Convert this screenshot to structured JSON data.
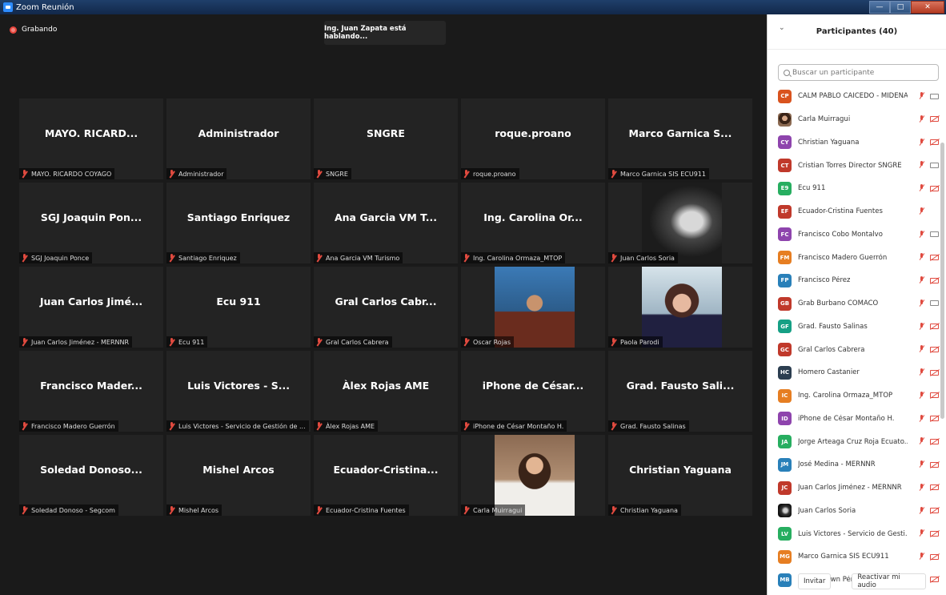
{
  "window": {
    "title": "Zoom Reunión"
  },
  "meeting": {
    "recording_label": "Grabando",
    "speaking_label": "Ing. Juan Zapata está hablando...",
    "tiles": [
      {
        "big": "MAYO. RICARD...",
        "label": "MAYO. RICARDO COYAGO"
      },
      {
        "big": "Administrador",
        "label": "Administrador"
      },
      {
        "big": "SNGRE",
        "label": "SNGRE"
      },
      {
        "big": "roque.proano",
        "label": "roque.proano"
      },
      {
        "big": "Marco Garnica S...",
        "label": "Marco Garnica SIS ECU911"
      },
      {
        "big": "SGJ Joaquin Pon...",
        "label": "SGJ Joaquin Ponce"
      },
      {
        "big": "Santiago Enriquez",
        "label": "Santiago Enriquez"
      },
      {
        "big": "Ana Garcia VM T...",
        "label": "Ana Garcia VM Turismo"
      },
      {
        "big": "Ing. Carolina Or...",
        "label": "Ing. Carolina Ormaza_MTOP"
      },
      {
        "big": "",
        "label": "Juan Carlos Soria",
        "photo": "juan"
      },
      {
        "big": "Juan Carlos Jimé...",
        "label": "Juan Carlos Jiménez - MERNNR"
      },
      {
        "big": "Ecu 911",
        "label": "Ecu 911"
      },
      {
        "big": "Gral Carlos Cabr...",
        "label": "Gral Carlos Cabrera"
      },
      {
        "big": "",
        "label": "Oscar Rojas",
        "photo": "oscar"
      },
      {
        "big": "",
        "label": "Paola Parodi",
        "photo": "paola"
      },
      {
        "big": "Francisco Mader...",
        "label": "Francisco Madero Guerrón"
      },
      {
        "big": "Luis Victores - S...",
        "label": "Luis Victores - Servicio de Gestión de ..."
      },
      {
        "big": "Àlex Rojas AME",
        "label": "Àlex Rojas AME"
      },
      {
        "big": "iPhone de César...",
        "label": "iPhone de César Montaño H."
      },
      {
        "big": "Grad. Fausto Sali...",
        "label": "Grad. Fausto Salinas"
      },
      {
        "big": "Soledad  Donoso...",
        "label": "Soledad Donoso - Segcom"
      },
      {
        "big": "Mishel Arcos",
        "label": "Mishel Arcos"
      },
      {
        "big": "Ecuador-Cristina...",
        "label": "Ecuador-Cristina Fuentes"
      },
      {
        "big": "",
        "label": "Carla Muirragui",
        "photo": "carla"
      },
      {
        "big": "Christian Yaguana",
        "label": "Christian Yaguana"
      }
    ]
  },
  "participants": {
    "title": "Participantes (40)",
    "search_placeholder": "Buscar un participante",
    "list": [
      {
        "initials": "CP",
        "color": "#d9531e",
        "name": "CALM PABLO CAICEDO - MIDENA",
        "video": "on"
      },
      {
        "initials": "",
        "color": "",
        "img": "img1",
        "name": "Carla Muirragui",
        "video": "off"
      },
      {
        "initials": "CY",
        "color": "#8e44ad",
        "name": "Christian Yaguana",
        "video": "off"
      },
      {
        "initials": "CT",
        "color": "#c0392b",
        "name": "Cristian Torres Director SNGRE",
        "video": "on"
      },
      {
        "initials": "E9",
        "color": "#27ae60",
        "name": "Ecu 911",
        "video": "off"
      },
      {
        "initials": "EF",
        "color": "#c0392b",
        "name": "Ecuador-Cristina Fuentes",
        "video": "none"
      },
      {
        "initials": "FC",
        "color": "#8e44ad",
        "name": "Francisco Cobo Montalvo",
        "video": "on"
      },
      {
        "initials": "FM",
        "color": "#e67e22",
        "name": "Francisco Madero Guerrón",
        "video": "off"
      },
      {
        "initials": "FP",
        "color": "#2980b9",
        "name": "Francisco Pérez",
        "video": "off"
      },
      {
        "initials": "GB",
        "color": "#c0392b",
        "name": "Grab Burbano COMACO",
        "video": "on"
      },
      {
        "initials": "GF",
        "color": "#16a085",
        "name": "Grad. Fausto Salinas",
        "video": "off"
      },
      {
        "initials": "GC",
        "color": "#c0392b",
        "name": "Gral Carlos Cabrera",
        "video": "off"
      },
      {
        "initials": "HC",
        "color": "#2c3e50",
        "name": "Homero Castanier",
        "video": "off"
      },
      {
        "initials": "IC",
        "color": "#e67e22",
        "name": "Ing. Carolina Ormaza_MTOP",
        "video": "off"
      },
      {
        "initials": "ID",
        "color": "#8e44ad",
        "name": "iPhone de César Montaño H.",
        "video": "off"
      },
      {
        "initials": "JA",
        "color": "#27ae60",
        "name": "Jorge Arteaga Cruz Roja Ecuato...",
        "video": "off"
      },
      {
        "initials": "JM",
        "color": "#2980b9",
        "name": "José Medina - MERNNR",
        "video": "off"
      },
      {
        "initials": "JC",
        "color": "#c0392b",
        "name": "Juan Carlos Jiménez - MERNNR",
        "video": "off"
      },
      {
        "initials": "",
        "color": "",
        "img": "img2",
        "name": "Juan Carlos Soria",
        "video": "off"
      },
      {
        "initials": "LV",
        "color": "#27ae60",
        "name": "Luis Victores - Servicio de Gesti...",
        "video": "off"
      },
      {
        "initials": "MG",
        "color": "#e67e22",
        "name": "Marco Garnica SIS ECU911",
        "video": "off"
      },
      {
        "initials": "MB",
        "color": "#2980b9",
        "name": "María Brown Pérez",
        "video": "off"
      }
    ],
    "invite_label": "Invitar",
    "unmute_label": "Reactivar mi audio"
  }
}
